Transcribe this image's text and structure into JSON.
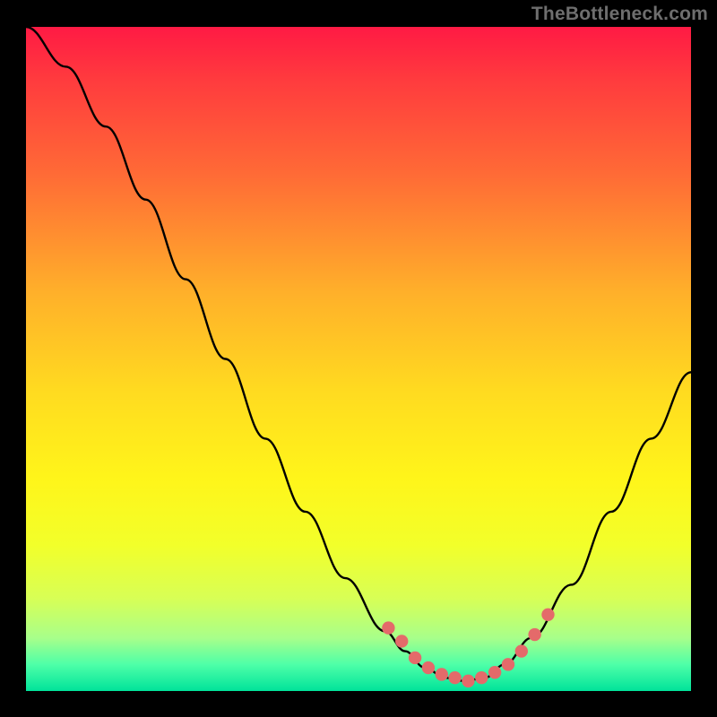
{
  "watermark": "TheBottleneck.com",
  "chart_data": {
    "type": "line",
    "title": "",
    "xlabel": "",
    "ylabel": "",
    "xlim": [
      0,
      100
    ],
    "ylim": [
      0,
      100
    ],
    "series": [
      {
        "name": "curve",
        "x": [
          0,
          6,
          12,
          18,
          24,
          30,
          36,
          42,
          48,
          54,
          57,
          60,
          63,
          66,
          69,
          72,
          76,
          82,
          88,
          94,
          100
        ],
        "values": [
          100,
          94,
          85,
          74,
          62,
          50,
          38,
          27,
          17,
          9,
          6,
          3.5,
          2,
          1.5,
          2,
          4,
          8,
          16,
          27,
          38,
          48
        ]
      }
    ],
    "markers": {
      "name": "highlight-points",
      "color": "#e46a6a",
      "x": [
        54.5,
        56.5,
        58.5,
        60.5,
        62.5,
        64.5,
        66.5,
        68.5,
        70.5,
        72.5,
        74.5,
        76.5,
        78.5
      ],
      "values": [
        9.5,
        7.5,
        5.0,
        3.5,
        2.5,
        2.0,
        1.5,
        2.0,
        2.8,
        4.0,
        6.0,
        8.5,
        11.5
      ]
    }
  }
}
